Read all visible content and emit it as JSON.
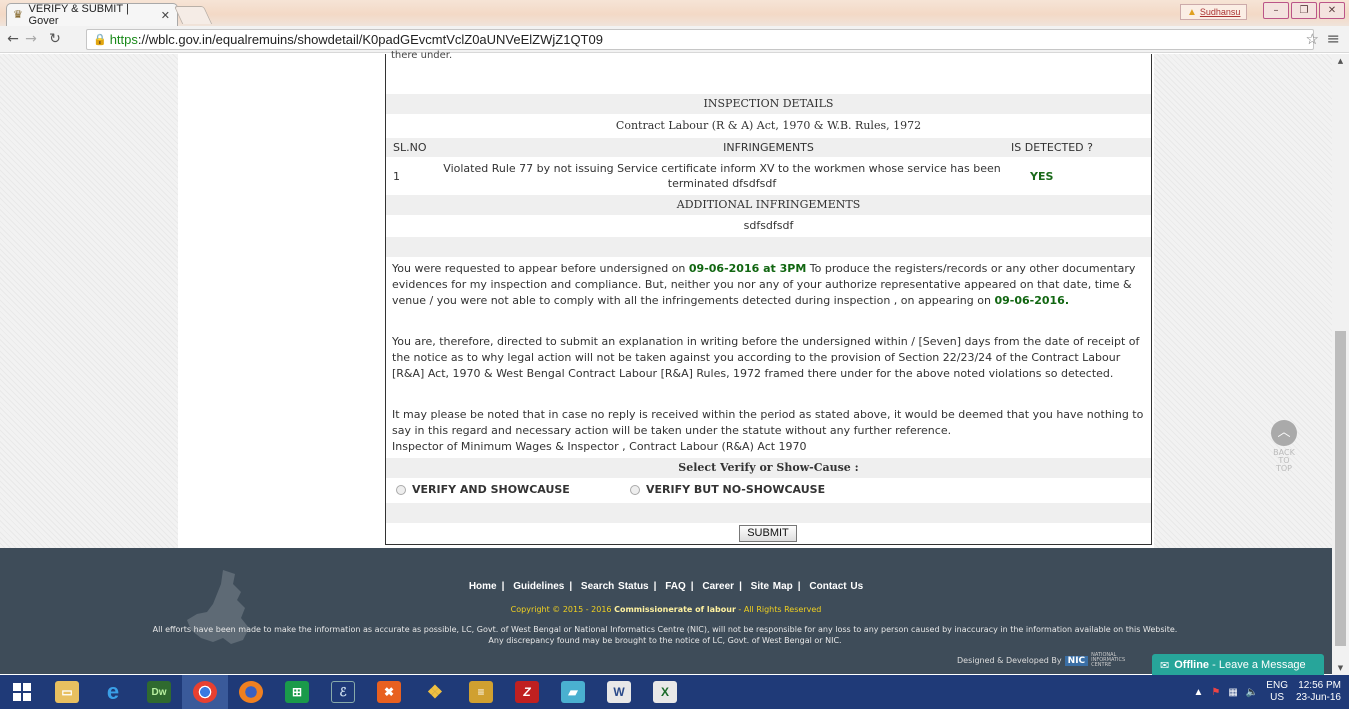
{
  "browser": {
    "tab_title": "VERIFY & SUBMIT | Gover",
    "url_scheme": "https",
    "url_rest": "://wblc.gov.in/equalremuins/showdetail/K0padGEvcmtVclZ0aUNVeElZWjZ1QT09",
    "user_name": "Sudhansu"
  },
  "page": {
    "top_fragment": "there under.",
    "inspection_header": "INSPECTION DETAILS",
    "act_title": "Contract Labour (R & A) Act, 1970 & W.B. Rules, 1972",
    "columns": {
      "sl": "SL.NO",
      "infringements": "INFRINGEMENTS",
      "detected": "IS DETECTED ?"
    },
    "infringements": [
      {
        "sl": "1",
        "text": "Violated Rule 77 by not issuing Service certificate inform XV to the workmen whose service has been terminated dfsdfsdf",
        "detected": "YES"
      }
    ],
    "additional_header": "ADDITIONAL INFRINGEMENTS",
    "additional_value": "sdfsdfsdf",
    "p1": {
      "a": "You were requested to appear before undersigned on ",
      "date_time": "09-06-2016 at 3PM",
      "b": " To produce the registers/records or any other documentary evidences for my inspection and compliance. But, neither you nor any of your authorize representative appeared on that date, time & venue / you were not able to comply with all the infringements detected during inspection , on appearing on ",
      "date": "09-06-2016."
    },
    "p2": "You are, therefore, directed to submit an explanation in writing before the undersigned within / [Seven] days from the date of receipt of the notice as to why legal action will not be taken against you according to the provision of Section 22/23/24 of the Contract Labour [R&A] Act, 1970 & West Bengal Contract Labour [R&A] Rules, 1972 framed there under for the above noted violations so detected.",
    "p3": "It may please be noted that in case no reply is received within the period as stated above, it would be deemed that you have nothing to say in this regard and necessary action will be taken under the statute without any further reference.",
    "p3_sign": "Inspector of Minimum Wages & Inspector , Contract Labour (R&A) Act 1970",
    "select_label": "Select Verify or Show-Cause :",
    "radio1": "VERIFY AND SHOWCAUSE",
    "radio2": "VERIFY BUT NO-SHOWCAUSE",
    "submit": "SUBMIT",
    "back_to_top": "BACK TO TOP"
  },
  "footer": {
    "links": [
      "Home",
      "Guidelines",
      "Search Status",
      "FAQ",
      "Career",
      "Site Map",
      "Contact Us"
    ],
    "copyright_pre": "Copyright © 2015 - 2016 ",
    "copyright_org": "Commissionerate of labour",
    "copyright_post": " - All Rights Reserved",
    "disclaimer": "All efforts have been made to make the information as accurate as possible, LC, Govt. of West Bengal or National Informatics Centre (NIC), will not be responsible for any loss to any person caused by inaccuracy in the information available on this Website. Any discrepancy found may be brought to the notice of LC, Govt. of West Bengal or NIC.",
    "designed_by": "Designed & Developed By",
    "nic": "NIC",
    "nic_sub": "NATIONAL INFORMATICS CENTRE"
  },
  "chat": {
    "status": "Offline",
    "label": " - Leave a Message"
  },
  "taskbar": {
    "lang1": "ENG",
    "lang2": "US",
    "time": "12:56 PM",
    "date": "23-Jun-16"
  },
  "colors": {
    "highlight": "#116611",
    "footer_bg": "#3e4c59",
    "chat": "#27a59a",
    "taskbar": "#1f3a78"
  }
}
